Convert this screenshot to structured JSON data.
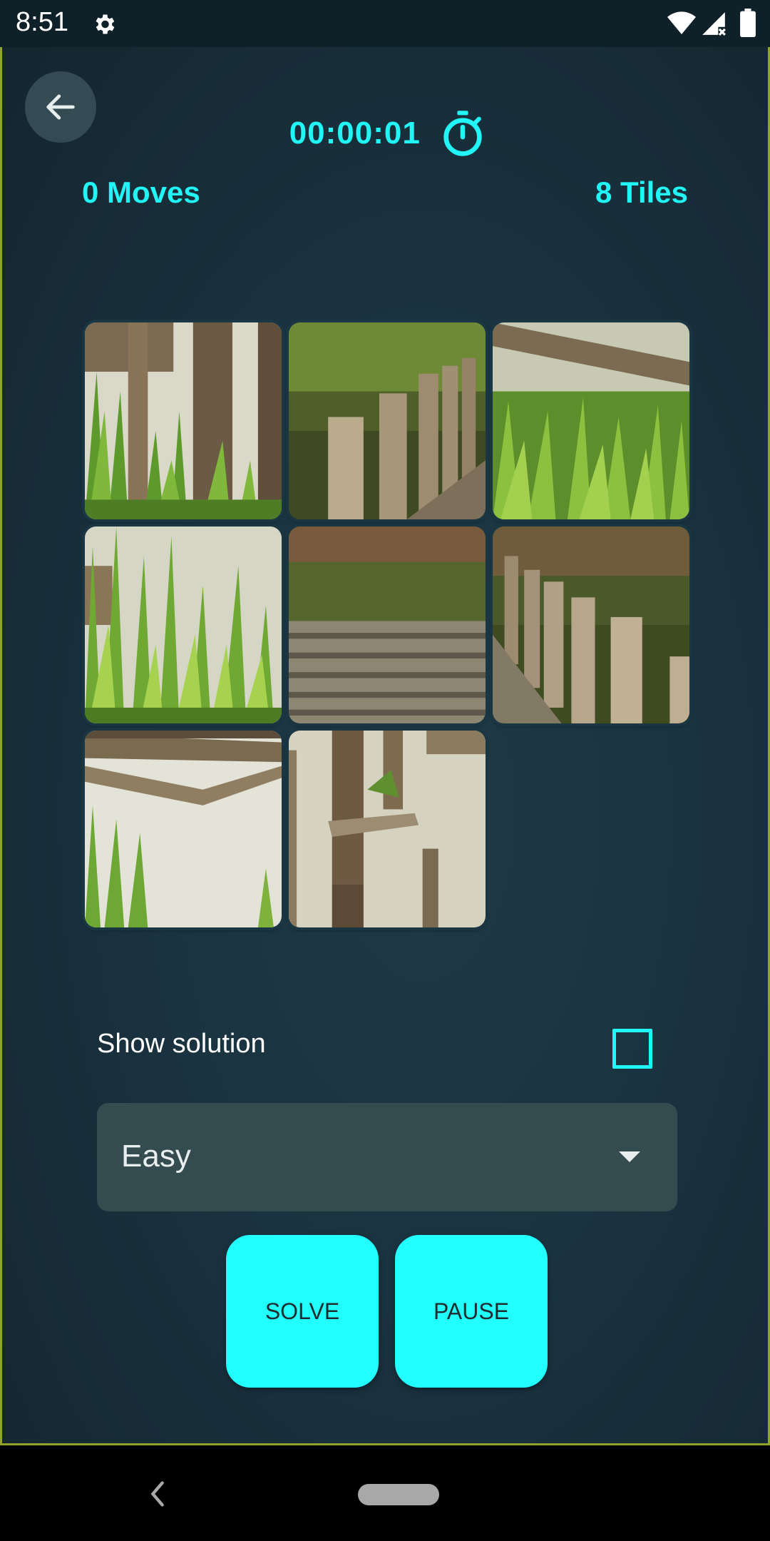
{
  "status_bar": {
    "time": "8:51",
    "icons": [
      "gear-icon",
      "wifi-icon",
      "signal-icon",
      "battery-icon"
    ]
  },
  "header": {
    "back_icon": "arrow-left-icon",
    "timer": "00:00:01",
    "timer_icon": "stopwatch-icon"
  },
  "stats": {
    "moves": "0 Moves",
    "tiles": "8 Tiles"
  },
  "board": {
    "grid": "3x3",
    "tiles": [
      {
        "position": 1,
        "image": "posts-and-grass-left"
      },
      {
        "position": 2,
        "image": "posts-in-water"
      },
      {
        "position": 3,
        "image": "fallen-log-and-grass"
      },
      {
        "position": 4,
        "image": "tall-grass"
      },
      {
        "position": 5,
        "image": "wooden-walkway"
      },
      {
        "position": 6,
        "image": "posts-and-walkway"
      },
      {
        "position": 7,
        "image": "broken-planks-reflection"
      },
      {
        "position": 8,
        "image": "post-reflection"
      },
      {
        "position": 9,
        "image": "empty"
      }
    ]
  },
  "options": {
    "show_solution_label": "Show solution",
    "show_solution_checked": false,
    "difficulty": "Easy"
  },
  "buttons": {
    "solve": "SOLVE",
    "pause": "PAUSE"
  },
  "colors": {
    "accent": "#21f5f5",
    "button": "#21ffff",
    "background": "#1a3340",
    "select": "#344b4f"
  },
  "nav_bar": {
    "icons": [
      "back-nav-icon",
      "home-pill"
    ]
  }
}
